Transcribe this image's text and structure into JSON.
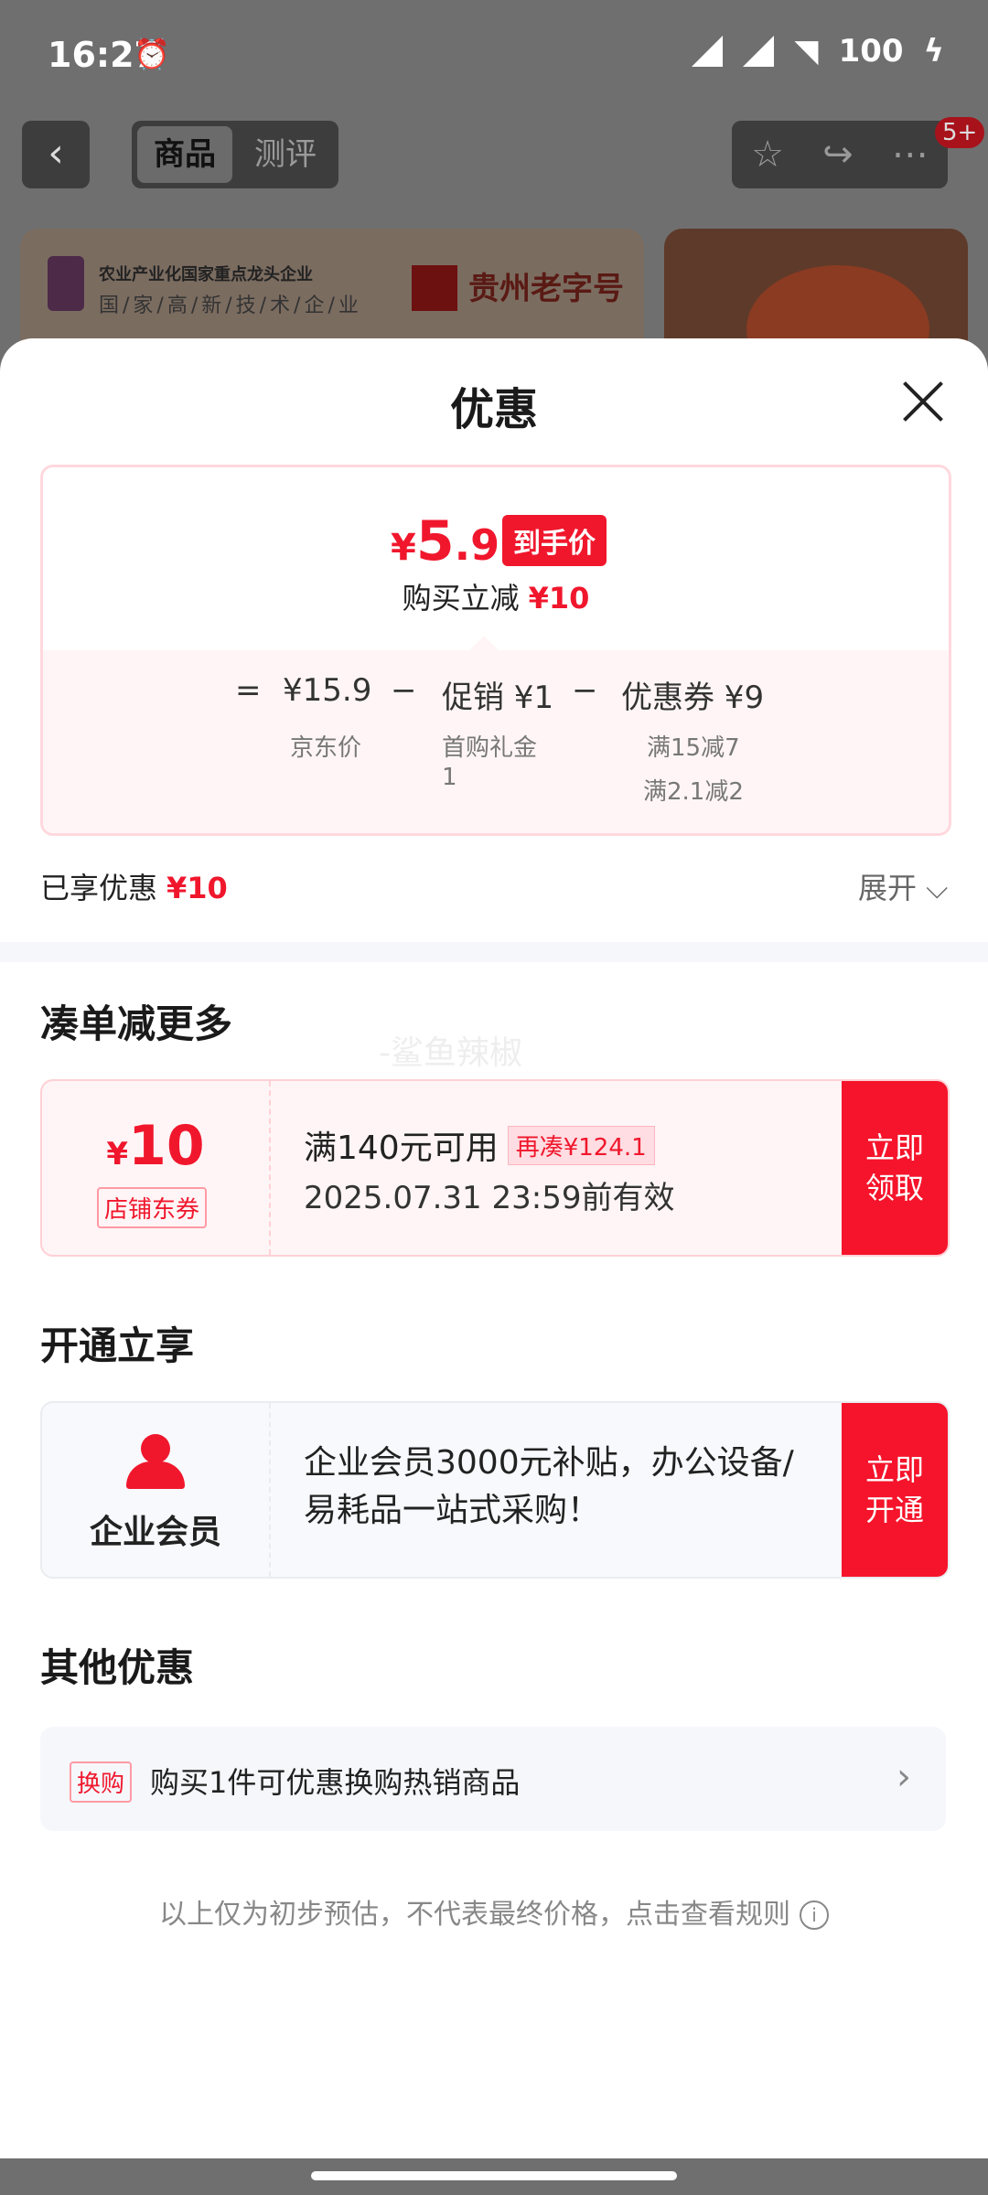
{
  "status_bar": {
    "time": "16:27",
    "left_icons": "🔕⏰",
    "battery": "100"
  },
  "top_nav": {
    "back": "‹",
    "tabs": [
      "商品",
      "测评"
    ],
    "notif_badge": "5+"
  },
  "banner": {
    "line1": "农业产业化国家重点龙头企业",
    "line2": "国/家/高/新/技/术/企/业",
    "brand": "贵州老字号"
  },
  "sheet": {
    "title": "优惠",
    "price": {
      "currency": "¥",
      "int": "5",
      "dec": ".9",
      "tag": "到手价",
      "save_label": "购买立减",
      "save_amount": "¥10",
      "equals": "=",
      "base": "¥15.9",
      "base_label": "京东价",
      "minus1": "−",
      "promo": "促销 ¥1",
      "promo_label": "首购礼金",
      "promo_label2": "1",
      "minus2": "−",
      "coupon": "优惠券 ¥9",
      "coupon_label1": "满15减7",
      "coupon_label2": "满2.1减2"
    },
    "enjoyed_label": "已享优惠",
    "enjoyed_amount": "¥10",
    "expand_label": "展开 ⌵",
    "section1_title": "凑单减更多",
    "watermark": "-鲨鱼辣椒",
    "coupon_card": {
      "currency": "¥",
      "amount": "10",
      "type": "店铺东券",
      "condition": "满140元可用",
      "more": "再凑¥124.1",
      "expiry": "2025.07.31 23:59前有效",
      "button": "立即\n领取"
    },
    "section2_title": "开通立享",
    "member_card": {
      "label": "企业会员",
      "desc": "企业会员3000元补贴，办公设备/易耗品一站式采购！",
      "button": "立即\n开通"
    },
    "section3_title": "其他优惠",
    "other_row": {
      "tag": "换购",
      "text": "购买1件可优惠换购热销商品",
      "chevron": "›"
    },
    "footnote": "以上仅为初步预估，不代表最终价格，点击查看规则"
  }
}
